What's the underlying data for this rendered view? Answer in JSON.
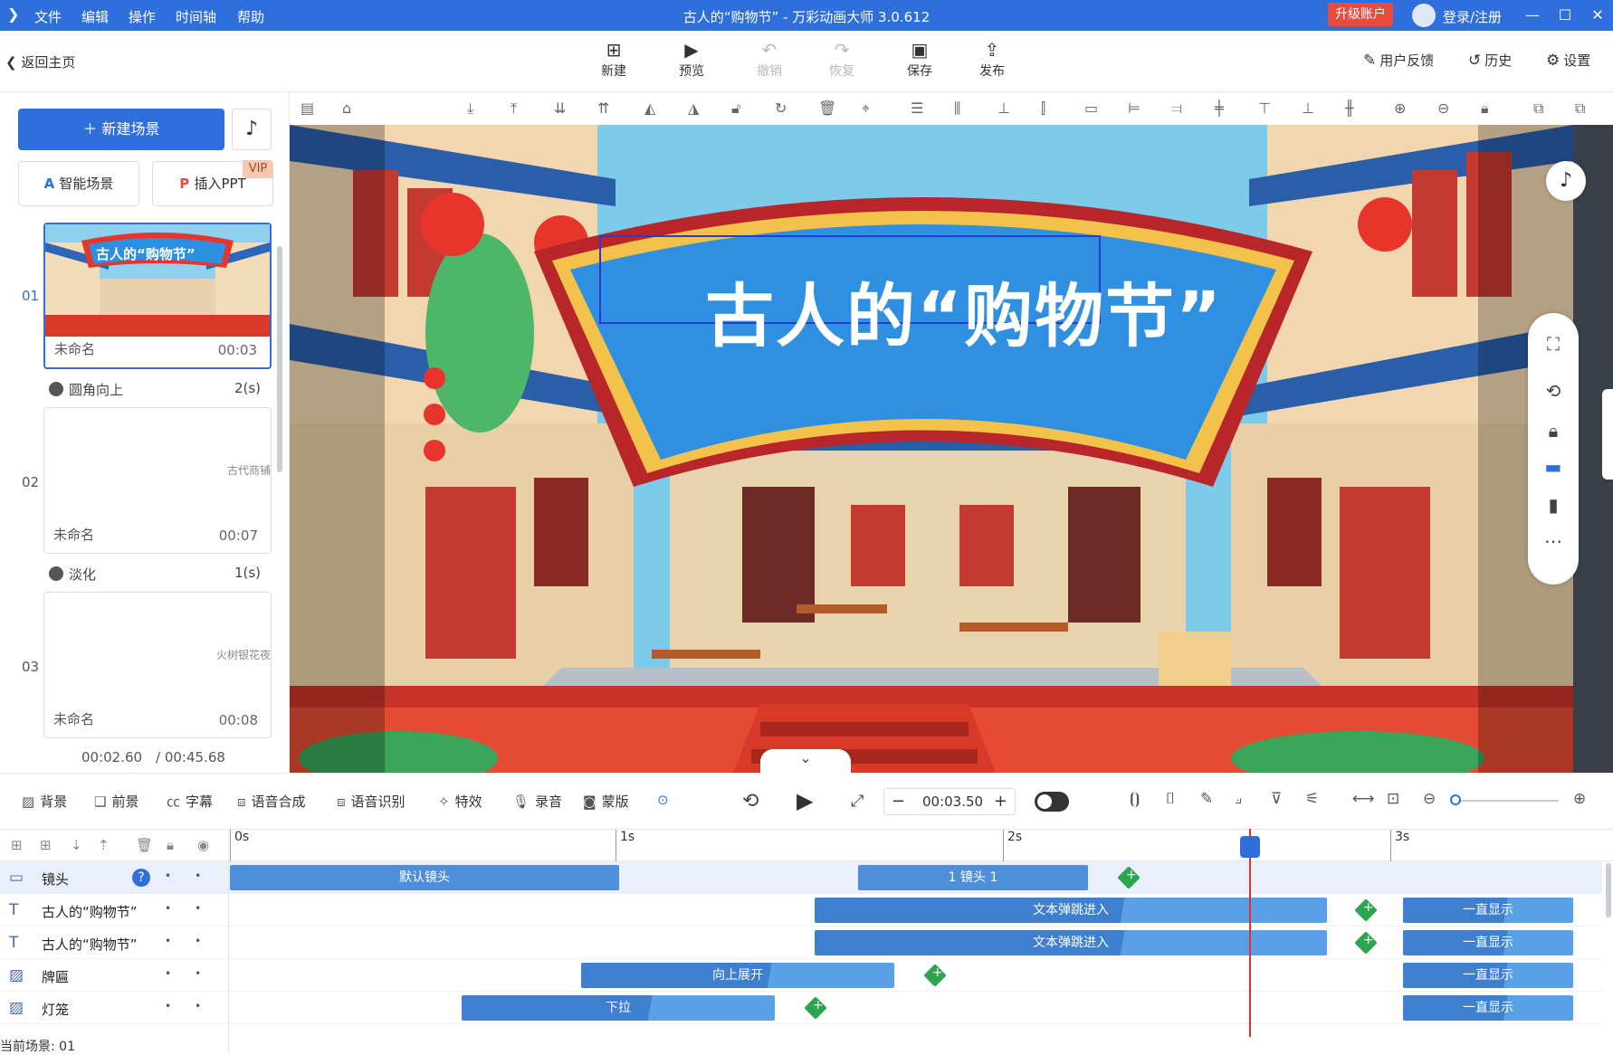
{
  "app": {
    "title": "古人的“购物节” - 万彩动画大师 3.0.612",
    "menu": [
      "文件",
      "编辑",
      "操作",
      "时间轴",
      "帮助"
    ],
    "upgrade": "升级账户",
    "login": "登录/注册",
    "window_controls": [
      "minimize-icon",
      "maximize-icon",
      "close-icon"
    ]
  },
  "toolbar": {
    "back": "返回主页",
    "buttons": [
      {
        "label": "新建",
        "icon": "new-icon",
        "enabled": true
      },
      {
        "label": "预览",
        "icon": "play-icon",
        "enabled": true
      },
      {
        "label": "撤销",
        "icon": "undo-icon",
        "enabled": false
      },
      {
        "label": "恢复",
        "icon": "redo-icon",
        "enabled": false
      },
      {
        "label": "保存",
        "icon": "save-icon",
        "enabled": true
      },
      {
        "label": "发布",
        "icon": "publish-icon",
        "enabled": true
      }
    ],
    "right": [
      {
        "label": "用户反馈",
        "icon": "feedback-icon"
      },
      {
        "label": "历史",
        "icon": "history-icon"
      },
      {
        "label": "设置",
        "icon": "settings-icon"
      }
    ]
  },
  "left": {
    "new_scene": "新建场景",
    "smart_scene": "智能场景",
    "insert_ppt": "插入PPT",
    "vip": "VIP",
    "scenes": [
      {
        "num": "01",
        "name": "未命名",
        "duration": "00:03",
        "thumb_title": "古人的“购物节”"
      },
      {
        "num": "02",
        "name": "未命名",
        "duration": "00:07",
        "thumb_title": "古代商铺"
      },
      {
        "num": "03",
        "name": "未命名",
        "duration": "00:08",
        "thumb_title": "火树银花夜"
      }
    ],
    "transitions": [
      {
        "name": "圆角向上",
        "time": "2(s)"
      },
      {
        "name": "淡化",
        "time": "1(s)"
      }
    ],
    "time_current": "00:02.60",
    "time_total": "/ 00:45.68"
  },
  "canvas": {
    "banner_text": "古人的“购物节”"
  },
  "bottom": {
    "tools": [
      {
        "label": "背景",
        "icon": "background-icon"
      },
      {
        "label": "前景",
        "icon": "foreground-icon"
      },
      {
        "label": "字幕",
        "icon": "subtitle-icon"
      },
      {
        "label": "语音合成",
        "icon": "tts-icon"
      },
      {
        "label": "语音识别",
        "icon": "asr-icon"
      },
      {
        "label": "特效",
        "icon": "effects-icon"
      },
      {
        "label": "录音",
        "icon": "mic-icon"
      },
      {
        "label": "蒙版",
        "icon": "mask-icon"
      }
    ],
    "time_value": "00:03.50",
    "ticks": [
      "0s",
      "1s",
      "2s",
      "3s"
    ],
    "current_scene": "当前场景: 01"
  },
  "timeline": {
    "tracks": [
      {
        "name": "镜头",
        "type": "camera",
        "icon": "camera-icon",
        "clips": [
          {
            "label": "默认镜头"
          },
          {
            "label": "1 镜头 1"
          }
        ]
      },
      {
        "name": "古人的“购物节”",
        "type": "text",
        "icon": "text-icon",
        "clips": [
          {
            "label": "文本弹跳进入"
          },
          {
            "label": "一直显示"
          }
        ]
      },
      {
        "name": "古人的“购物节”",
        "type": "text",
        "icon": "text-icon",
        "clips": [
          {
            "label": "文本弹跳进入"
          },
          {
            "label": "一直显示"
          }
        ]
      },
      {
        "name": "牌匾",
        "type": "image",
        "icon": "image-icon",
        "clips": [
          {
            "label": "向上展开"
          },
          {
            "label": "一直显示"
          }
        ]
      },
      {
        "name": "灯笼",
        "type": "image",
        "icon": "image-icon",
        "clips": [
          {
            "label": "下拉"
          },
          {
            "label": "一直显示"
          }
        ]
      }
    ]
  }
}
